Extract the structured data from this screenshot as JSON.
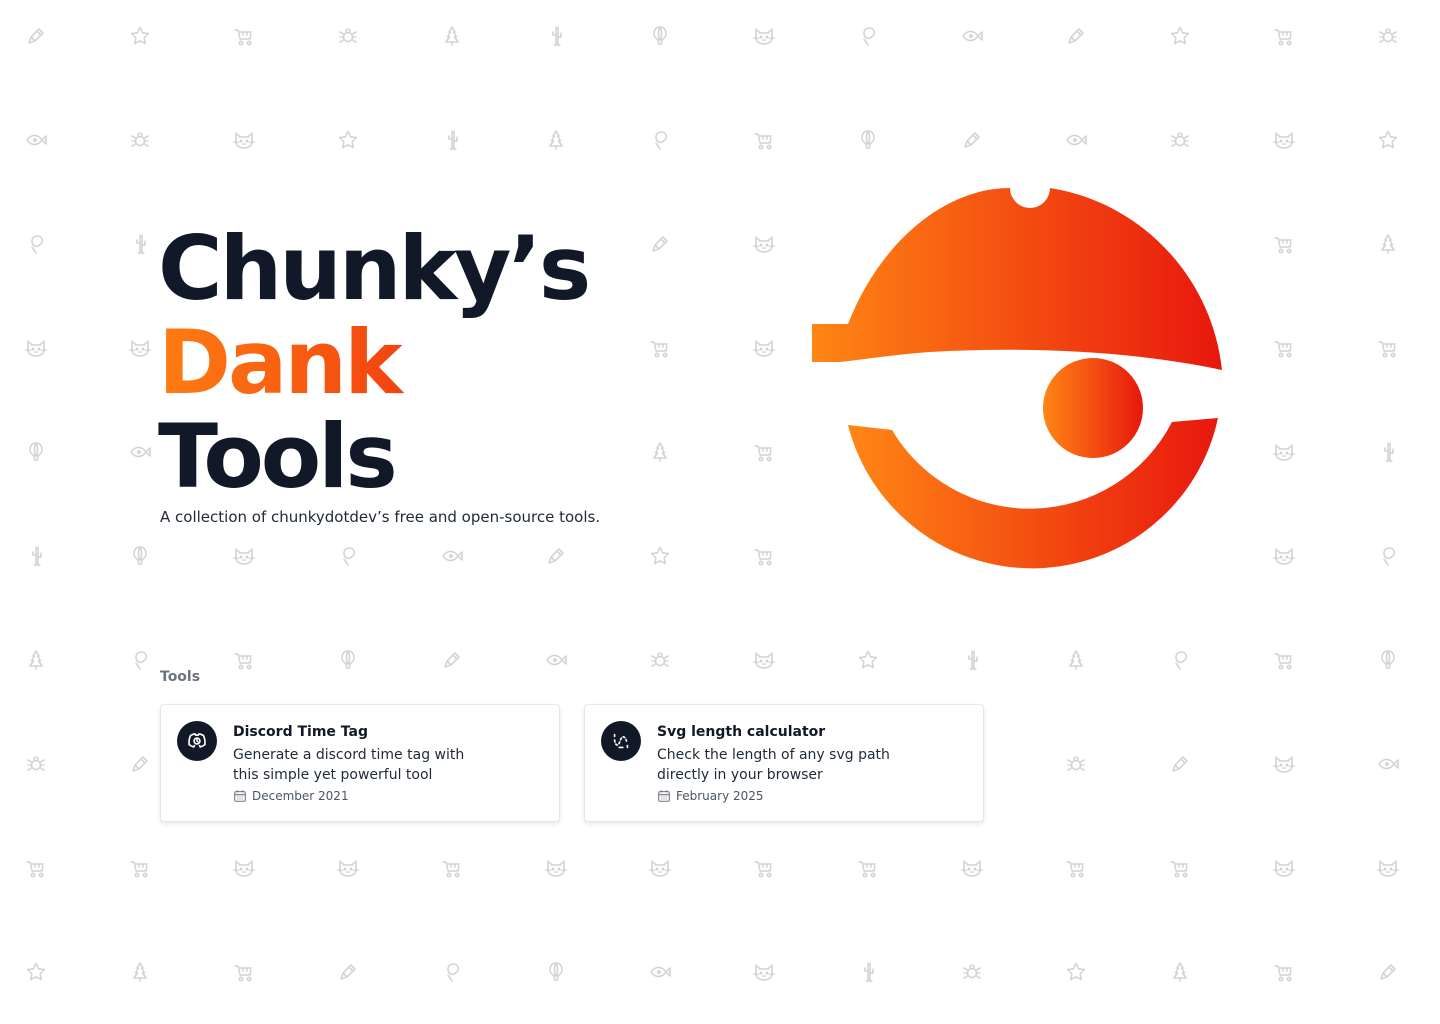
{
  "hero": {
    "title_line1": "Chunky’s",
    "title_line2": "Dank",
    "title_line3": "Tools",
    "subtitle": "A collection of chunkydotdev’s free and open-source tools."
  },
  "colors": {
    "accent_start": "#ff7d12",
    "accent_end": "#e9170e",
    "text_dark": "#111827",
    "pattern_icon": "#d4d4d4"
  },
  "tools_section": {
    "label": "Tools",
    "cards": [
      {
        "title": "Discord Time Tag",
        "description": "Generate a discord time tag with this simple yet powerful tool",
        "date": "December 2021",
        "icon": "discord-clock-icon"
      },
      {
        "title": "Svg length calculator",
        "description": "Check the length of any svg path directly in your browser",
        "date": "February 2025",
        "icon": "svg-path-icon"
      }
    ]
  },
  "background_icons": [
    "pencil-icon",
    "bug-icon",
    "balloon-icon",
    "fish-icon",
    "stroller-icon",
    "cactus-icon",
    "map-pin-icon",
    "star-icon",
    "tree-icon",
    "cat-icon"
  ]
}
